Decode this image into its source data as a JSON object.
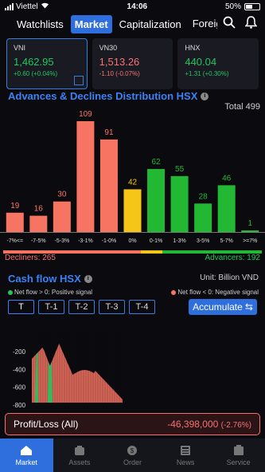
{
  "status": {
    "carrier": "Viettel",
    "time": "14:06",
    "battery": "50%"
  },
  "tabs": [
    {
      "label": "Watchlists",
      "active": false
    },
    {
      "label": "Market",
      "active": true
    },
    {
      "label": "Capitalization",
      "active": false
    },
    {
      "label": "Foreig",
      "active": false
    }
  ],
  "cards": [
    {
      "name": "VNI",
      "price": "1,462.95",
      "change": "+0.60 (+0.04%)",
      "dir": "up"
    },
    {
      "name": "VN30",
      "price": "1,513.26",
      "change": "-1.10 (-0.07%)",
      "dir": "dn"
    },
    {
      "name": "HNX",
      "price": "440.04",
      "change": "+1.31 (+0.30%)",
      "dir": "up"
    }
  ],
  "ad": {
    "title": "Advances & Declines Distribution HSX",
    "total": "Total 499",
    "decliners": "Decliners: 265",
    "advancers": "Advancers: 192"
  },
  "chart_data": [
    {
      "type": "bar",
      "categories": [
        "-7%<=",
        "-7-5%",
        "-5-3%",
        "-3-1%",
        "-1-0%",
        "0%",
        "0-1%",
        "1-3%",
        "3-5%",
        "5-7%",
        ">=7%"
      ],
      "values": [
        19,
        16,
        30,
        109,
        91,
        42,
        62,
        55,
        28,
        46,
        1
      ],
      "colors": [
        "#f87462",
        "#f87462",
        "#f87462",
        "#f87462",
        "#f87462",
        "#f5c518",
        "#22b833",
        "#22b833",
        "#22b833",
        "#22b833",
        "#22b833"
      ]
    },
    {
      "type": "area",
      "yticks": [
        -200,
        -400,
        -600,
        -800
      ],
      "ylim": [
        -900,
        0
      ],
      "series_colors": {
        "positive": "#22c55e",
        "negative": "#f87462"
      }
    }
  ],
  "cashflow": {
    "title": "Cash flow HSX",
    "unit": "Unit: Billion VND",
    "pos_label": "Net flow > 0: Positive signal",
    "neg_label": "Net flow < 0: Negative signal",
    "periods": [
      "T",
      "T-1",
      "T-2",
      "T-3",
      "T-4"
    ],
    "accumulate": "Accumulate"
  },
  "pl": {
    "label": "Profit/Loss (All)",
    "value": "-46,398,000",
    "pct": "(-2.76%)"
  },
  "nav": [
    {
      "label": "Market",
      "icon": "market-icon",
      "active": true
    },
    {
      "label": "Assets",
      "icon": "assets-icon",
      "active": false
    },
    {
      "label": "Order",
      "icon": "order-icon",
      "active": false
    },
    {
      "label": "News",
      "icon": "news-icon",
      "active": false
    },
    {
      "label": "Service",
      "icon": "service-icon",
      "active": false
    }
  ]
}
